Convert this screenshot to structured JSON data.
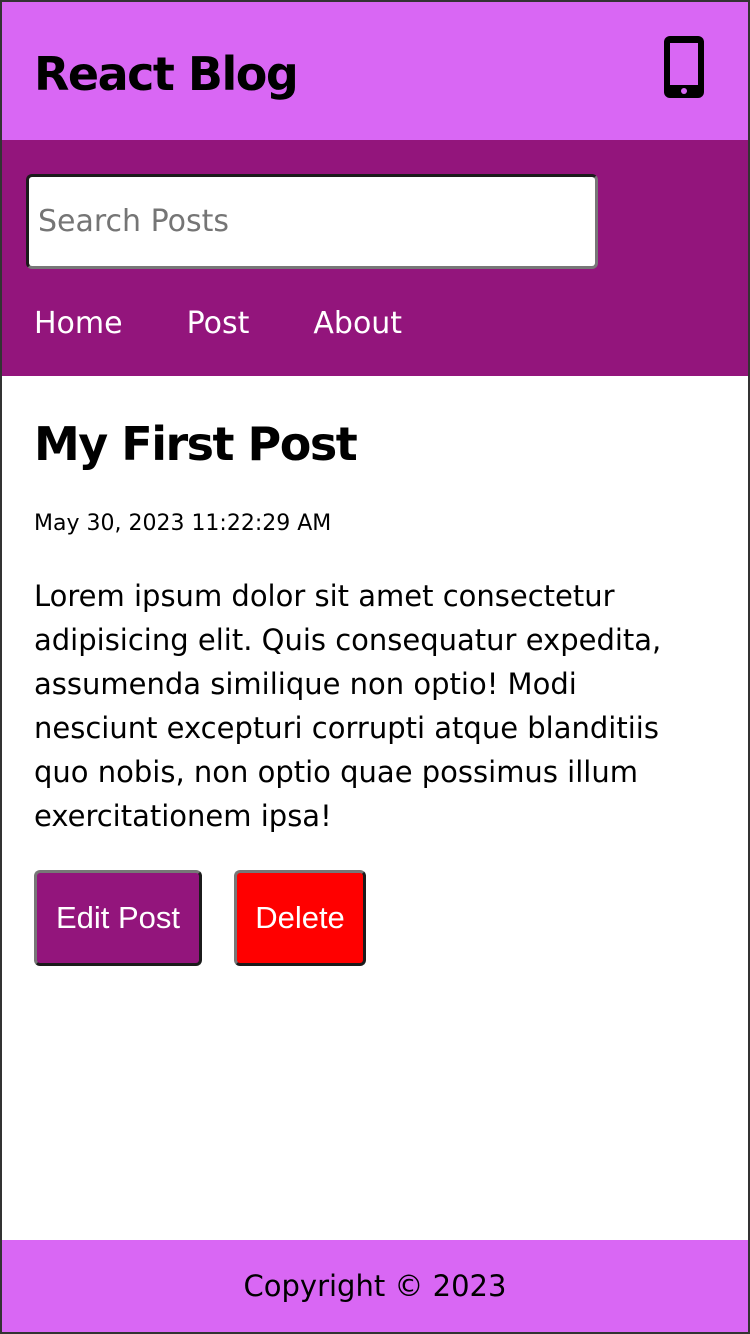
{
  "header": {
    "title": "React Blog",
    "device_icon": "mobile-phone-icon"
  },
  "nav": {
    "search": {
      "value": "",
      "placeholder": "Search Posts"
    },
    "links": [
      {
        "label": "Home"
      },
      {
        "label": "Post"
      },
      {
        "label": "About"
      }
    ]
  },
  "post": {
    "title": "My First Post",
    "datetime": "May 30, 2023 11:22:29 AM",
    "body": "Lorem ipsum dolor sit amet consectetur adipisicing elit. Quis consequatur expedita, assumenda similique non optio! Modi nesciunt excepturi corrupti atque blanditiis quo nobis, non optio quae possimus illum exercitationem ipsa!",
    "edit_label": "Edit Post",
    "delete_label": "Delete"
  },
  "footer": {
    "text": "Copyright © 2023"
  },
  "colors": {
    "header_bg": "#d967f4",
    "nav_bg": "#93157c",
    "edit_button_bg": "#93157c",
    "delete_button_bg": "#ff0000",
    "footer_bg": "#d967f4"
  }
}
